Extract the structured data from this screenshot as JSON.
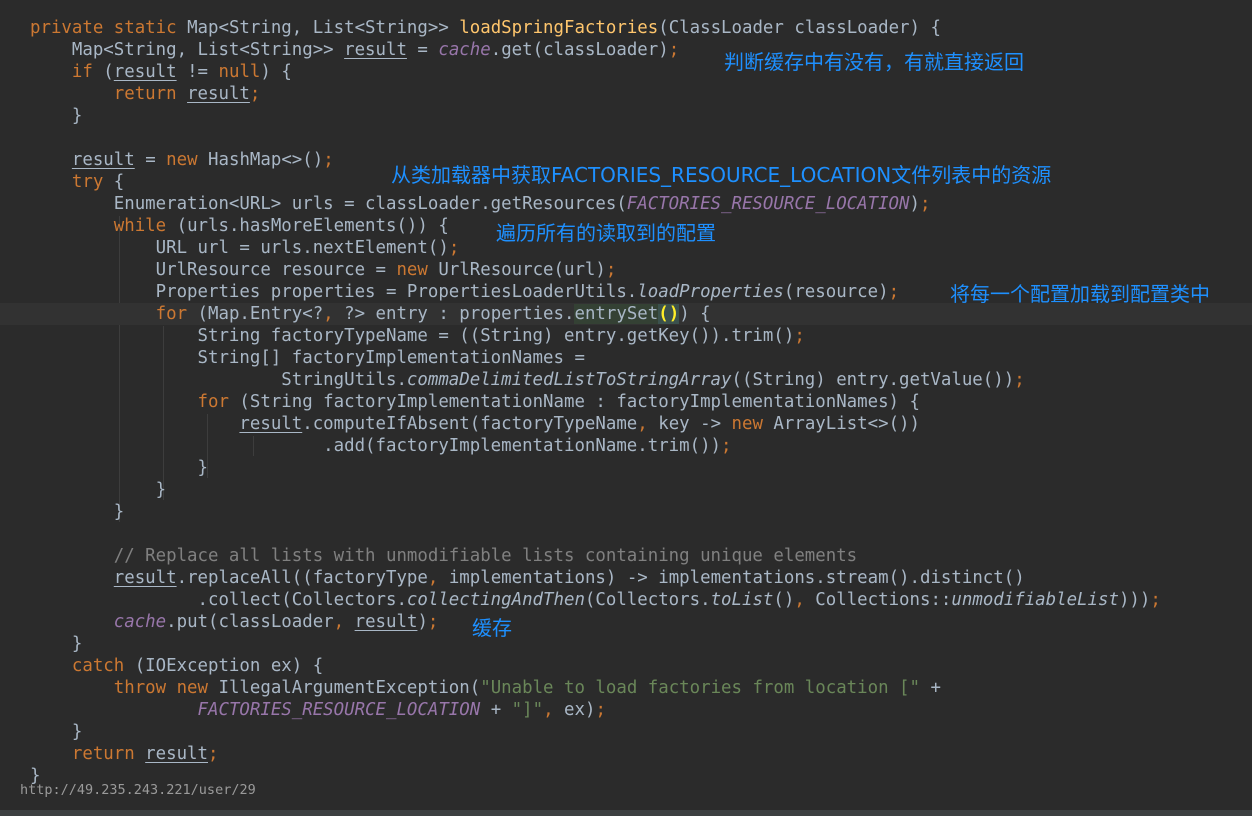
{
  "code_lines": [
    [
      [
        "kw",
        "private static "
      ],
      [
        "",
        "Map<String, List<String>> "
      ],
      [
        "fn",
        "loadSpringFactories"
      ],
      [
        "",
        "(ClassLoader classLoader) {"
      ]
    ],
    [
      [
        "",
        "    Map<String, List<String>> "
      ],
      [
        "uv",
        "result"
      ],
      [
        "",
        " = "
      ],
      [
        "fld",
        "cache"
      ],
      [
        "",
        ".get(classLoader)"
      ],
      [
        "kw",
        ";"
      ]
    ],
    [
      [
        "kw",
        "    if "
      ],
      [
        "",
        "("
      ],
      [
        "uv",
        "result"
      ],
      [
        "",
        " != "
      ],
      [
        "kw",
        "null"
      ],
      [
        "",
        ") {"
      ]
    ],
    [
      [
        "kw",
        "        return "
      ],
      [
        "uv",
        "result"
      ],
      [
        "kw",
        ";"
      ]
    ],
    [
      [
        "",
        "    }"
      ]
    ],
    [
      [
        "",
        ""
      ]
    ],
    [
      [
        "",
        "    "
      ],
      [
        "uv",
        "result"
      ],
      [
        "",
        " = "
      ],
      [
        "kw",
        "new "
      ],
      [
        "",
        "HashMap<>()"
      ],
      [
        "kw",
        ";"
      ]
    ],
    [
      [
        "kw",
        "    try "
      ],
      [
        "",
        "{"
      ]
    ],
    [
      [
        "",
        "        Enumeration<URL> urls = classLoader.getResources("
      ],
      [
        "fld",
        "FACTORIES_RESOURCE_LOCATION"
      ],
      [
        "",
        ")"
      ],
      [
        "kw",
        ";"
      ]
    ],
    [
      [
        "kw",
        "        while "
      ],
      [
        "",
        "(urls.hasMoreElements()) {"
      ]
    ],
    [
      [
        "",
        "            URL url = urls.nextElement()"
      ],
      [
        "kw",
        ";"
      ]
    ],
    [
      [
        "",
        "            UrlResource resource = "
      ],
      [
        "kw",
        "new "
      ],
      [
        "",
        "UrlResource(url)"
      ],
      [
        "kw",
        ";"
      ]
    ],
    [
      [
        "",
        "            Properties properties = PropertiesLoaderUtils."
      ],
      [
        "st",
        "loadProperties"
      ],
      [
        "",
        "(resource)"
      ],
      [
        "kw",
        ";"
      ]
    ],
    [
      [
        "kw",
        "            for "
      ],
      [
        "",
        "(Map.Entry<?"
      ],
      [
        "kw",
        ", "
      ],
      [
        "",
        "?> entry : properties."
      ],
      [
        "mh",
        "entrySet"
      ],
      [
        "hl",
        "()"
      ],
      [
        "",
        ") {"
      ]
    ],
    [
      [
        "",
        "                String factoryTypeName = ((String) entry.getKey()).trim()"
      ],
      [
        "kw",
        ";"
      ]
    ],
    [
      [
        "",
        "                String[] factoryImplementationNames ="
      ]
    ],
    [
      [
        "",
        "                        StringUtils."
      ],
      [
        "st",
        "commaDelimitedListToStringArray"
      ],
      [
        "",
        "((String) entry.getValue())"
      ],
      [
        "kw",
        ";"
      ]
    ],
    [
      [
        "kw",
        "                for "
      ],
      [
        "",
        "(String factoryImplementationName : factoryImplementationNames) {"
      ]
    ],
    [
      [
        "",
        "                    "
      ],
      [
        "uv",
        "result"
      ],
      [
        "",
        ".computeIfAbsent(factoryTypeName"
      ],
      [
        "kw",
        ", "
      ],
      [
        "",
        "key -> "
      ],
      [
        "kw",
        "new "
      ],
      [
        "",
        "ArrayList<>())"
      ]
    ],
    [
      [
        "",
        "                            .add(factoryImplementationName.trim())"
      ],
      [
        "kw",
        ";"
      ]
    ],
    [
      [
        "",
        "                }"
      ]
    ],
    [
      [
        "",
        "            }"
      ]
    ],
    [
      [
        "",
        "        }"
      ]
    ],
    [
      [
        "",
        ""
      ]
    ],
    [
      [
        "cm",
        "        // Replace all lists with unmodifiable lists containing unique elements"
      ]
    ],
    [
      [
        "",
        "        "
      ],
      [
        "uv",
        "result"
      ],
      [
        "",
        ".replaceAll((factoryType"
      ],
      [
        "kw",
        ", "
      ],
      [
        "",
        "implementations) -> implementations.stream().distinct()"
      ]
    ],
    [
      [
        "",
        "                .collect(Collectors."
      ],
      [
        "st",
        "collectingAndThen"
      ],
      [
        "",
        "(Collectors."
      ],
      [
        "st",
        "toList"
      ],
      [
        "",
        "()"
      ],
      [
        "kw",
        ", "
      ],
      [
        "",
        "Collections::"
      ],
      [
        "st",
        "unmodifiableList"
      ],
      [
        "",
        ")))"
      ],
      [
        "kw",
        ";"
      ]
    ],
    [
      [
        "",
        "        "
      ],
      [
        "fld",
        "cache"
      ],
      [
        "",
        ".put(classLoader"
      ],
      [
        "kw",
        ", "
      ],
      [
        "uv",
        "result"
      ],
      [
        "",
        ")"
      ],
      [
        "kw",
        ";"
      ]
    ],
    [
      [
        "",
        "    }"
      ]
    ],
    [
      [
        "kw",
        "    catch "
      ],
      [
        "",
        "(IOException ex) {"
      ]
    ],
    [
      [
        "kw",
        "        throw new "
      ],
      [
        "",
        "IllegalArgumentException("
      ],
      [
        "str",
        "\"Unable to load factories from location [\""
      ],
      [
        "",
        " +"
      ]
    ],
    [
      [
        "",
        "                "
      ],
      [
        "fld",
        "FACTORIES_RESOURCE_LOCATION"
      ],
      [
        "",
        " + "
      ],
      [
        "str",
        "\"]\""
      ],
      [
        "kw",
        ", "
      ],
      [
        "",
        "ex)"
      ],
      [
        "kw",
        ";"
      ]
    ],
    [
      [
        "",
        "    }"
      ]
    ],
    [
      [
        "kw",
        "    return "
      ],
      [
        "uv",
        "result"
      ],
      [
        "kw",
        ";"
      ]
    ],
    [
      [
        "",
        "}"
      ]
    ]
  ],
  "annotations": {
    "cache_check": "判断缓存中有没有，有就直接返回",
    "get_resources": "从类加载器中获取FACTORIES_RESOURCE_LOCATION文件列表中的资源",
    "iterate": "遍历所有的读取到的配置",
    "load_each": "将每一个配置加载到配置类中",
    "cache_put": "缓存"
  },
  "watermark": "http://49.235.243.221/user/29",
  "colors": {
    "background": "#2b2b2b",
    "keyword": "#cc7832",
    "method_declaration": "#ffc66d",
    "static_field": "#9876aa",
    "comment": "#808080",
    "string": "#6a8759",
    "annotation_text": "#1e90ff"
  }
}
